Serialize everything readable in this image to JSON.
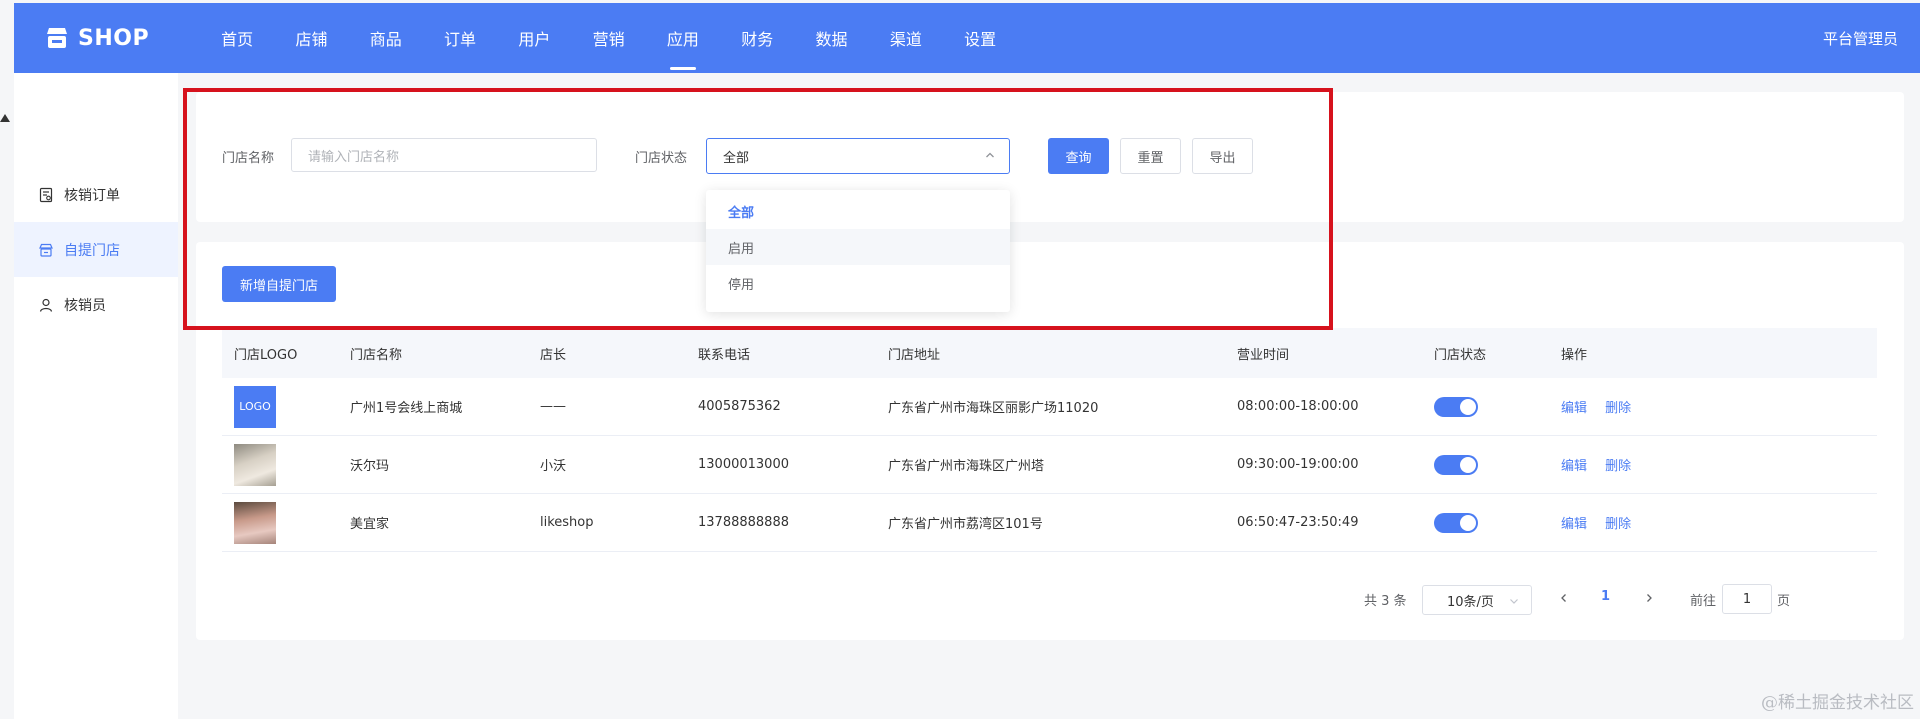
{
  "colors": {
    "brand": "#4b7cf3",
    "highlight": "#d6121d"
  },
  "header": {
    "logo": "SHOP",
    "nav": [
      "首页",
      "店铺",
      "商品",
      "订单",
      "用户",
      "营销",
      "应用",
      "财务",
      "数据",
      "渠道",
      "设置"
    ],
    "active_nav": "应用",
    "admin": "平台管理员"
  },
  "sidebar": {
    "items": [
      {
        "label": "核销订单",
        "icon": "receipt-icon"
      },
      {
        "label": "自提门店",
        "icon": "store-icon",
        "active": true
      },
      {
        "label": "核销员",
        "icon": "user-icon"
      }
    ]
  },
  "filter": {
    "name_label": "门店名称",
    "name_placeholder": "请输入门店名称",
    "status_label": "门店状态",
    "status_value": "全部",
    "query": "查询",
    "reset": "重置",
    "export": "导出"
  },
  "dropdown": {
    "options": [
      "全部",
      "启用",
      "停用"
    ],
    "selected": "全部"
  },
  "actions": {
    "add_store": "新增自提门店"
  },
  "table": {
    "columns": [
      "门店LOGO",
      "门店名称",
      "店长",
      "联系电话",
      "门店地址",
      "营业时间",
      "门店状态",
      "操作"
    ],
    "rows": [
      {
        "logo": "LOGO",
        "name": "广州1号会线上商城",
        "manager": "——",
        "phone": "4005875362",
        "address": "广东省广州市海珠区丽影广场11020",
        "hours": "08:00:00-18:00:00",
        "enabled": true
      },
      {
        "logo": "photo",
        "name": "沃尔玛",
        "manager": "小沃",
        "phone": "13000013000",
        "address": "广东省广州市海珠区广州塔",
        "hours": "09:30:00-19:00:00",
        "enabled": true
      },
      {
        "logo": "photo",
        "name": "美宜家",
        "manager": "likeshop",
        "phone": "13788888888",
        "address": "广东省广州市荔湾区101号",
        "hours": "06:50:47-23:50:49",
        "enabled": true
      }
    ],
    "edit": "编辑",
    "delete": "删除"
  },
  "pagination": {
    "total": "共 3 条",
    "page_size": "10条/页",
    "current_page": "1",
    "goto_label": "前往",
    "goto_value": "1",
    "page_unit": "页"
  },
  "watermark": "@稀土掘金技术社区"
}
